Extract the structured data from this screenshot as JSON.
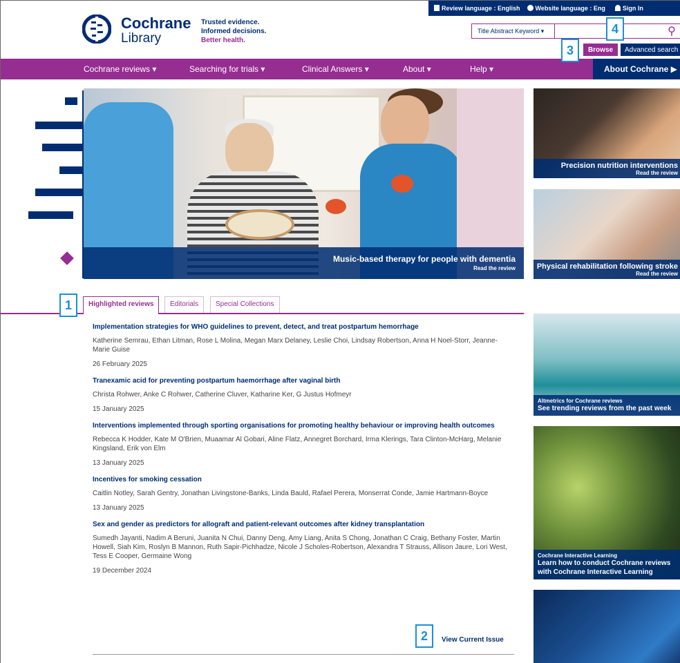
{
  "topbar": {
    "review_language": "Review language : English",
    "website_language": "Website language : Eng",
    "sign_in": "Sign In"
  },
  "brand": {
    "name_line1": "Cochrane",
    "name_line2": "Library",
    "tagline_1": "Trusted evidence.",
    "tagline_2": "Informed decisions.",
    "tagline_3": "Better health.",
    "accent_color": "#962d91",
    "navy_color": "#002d72"
  },
  "search": {
    "field_select": "Title Abstract Keyword",
    "value": "",
    "browse_label": "Browse",
    "advanced_label": "Advanced search"
  },
  "nav": {
    "items": [
      {
        "label": "Cochrane reviews ▾"
      },
      {
        "label": "Searching for trials ▾"
      },
      {
        "label": "Clinical Answers ▾"
      },
      {
        "label": "About ▾"
      },
      {
        "label": "Help ▾"
      }
    ],
    "about_cochrane": "About Cochrane ▶"
  },
  "hero": {
    "title": "Music-based therapy for people with dementia",
    "link": "Read the review"
  },
  "side_cards": [
    {
      "title": "Precision nutrition interventions",
      "link": "Read the review"
    },
    {
      "title": "Physical rehabilitation following stroke",
      "link": "Read the review"
    },
    {
      "subtitle": "Altmetrics for Cochrane reviews",
      "title": "See trending reviews from the past week"
    },
    {
      "subtitle": "Cochrane Interactive Learning",
      "title": "Learn how to conduct Cochrane reviews with Cochrane Interactive Learning"
    }
  ],
  "tabs": [
    {
      "label": "Highlighted reviews",
      "active": true
    },
    {
      "label": "Editorials",
      "active": false
    },
    {
      "label": "Special Collections",
      "active": false
    }
  ],
  "reviews": [
    {
      "title": "Implementation strategies for WHO guidelines to prevent, detect, and treat postpartum hemorrhage",
      "authors": "Katherine Semrau, Ethan Litman, Rose L Molina, Megan Marx Delaney, Leslie Choi, Lindsay Robertson, Anna H Noel-Storr, Jeanne-Marie Guise",
      "date": "26 February 2025"
    },
    {
      "title": "Tranexamic acid for preventing postpartum haemorrhage after vaginal birth",
      "authors": "Christa Rohwer, Anke C Rohwer, Catherine Cluver, Katharine Ker, G Justus Hofmeyr",
      "date": "15 January 2025"
    },
    {
      "title": "Interventions implemented through sporting organisations for promoting healthy behaviour or improving health outcomes",
      "authors": "Rebecca K Hodder, Kate M O'Brien, Muaamar Al Gobari, Aline Flatz, Annegret Borchard, Irma Klerings, Tara Clinton-McHarg, Melanie Kingsland, Erik von Elm",
      "date": "13 January 2025"
    },
    {
      "title": "Incentives for smoking cessation",
      "authors": "Caitlin Notley, Sarah Gentry, Jonathan Livingstone-Banks, Linda Bauld, Rafael Perera, Monserrat Conde, Jamie Hartmann-Boyce",
      "date": "13 January 2025"
    },
    {
      "title": "Sex and gender as predictors for allograft and patient-relevant outcomes after kidney transplantation",
      "authors": "Sumedh Jayanti, Nadim A Beruni, Juanita N Chui, Danny Deng, Amy Liang, Anita S Chong, Jonathan C Craig, Bethany Foster, Martin Howell, Siah Kim, Roslyn B Mannon, Ruth Sapir-Pichhadze, Nicole J Scholes-Robertson, Alexandra T Strauss, Allison Jaure, Lori West, Tess E Cooper, Germaine Wong",
      "date": "19 December 2024"
    }
  ],
  "view_current_issue": "View Current Issue",
  "annotations": {
    "a1": "1",
    "a2": "2",
    "a3": "3",
    "a4": "4"
  }
}
